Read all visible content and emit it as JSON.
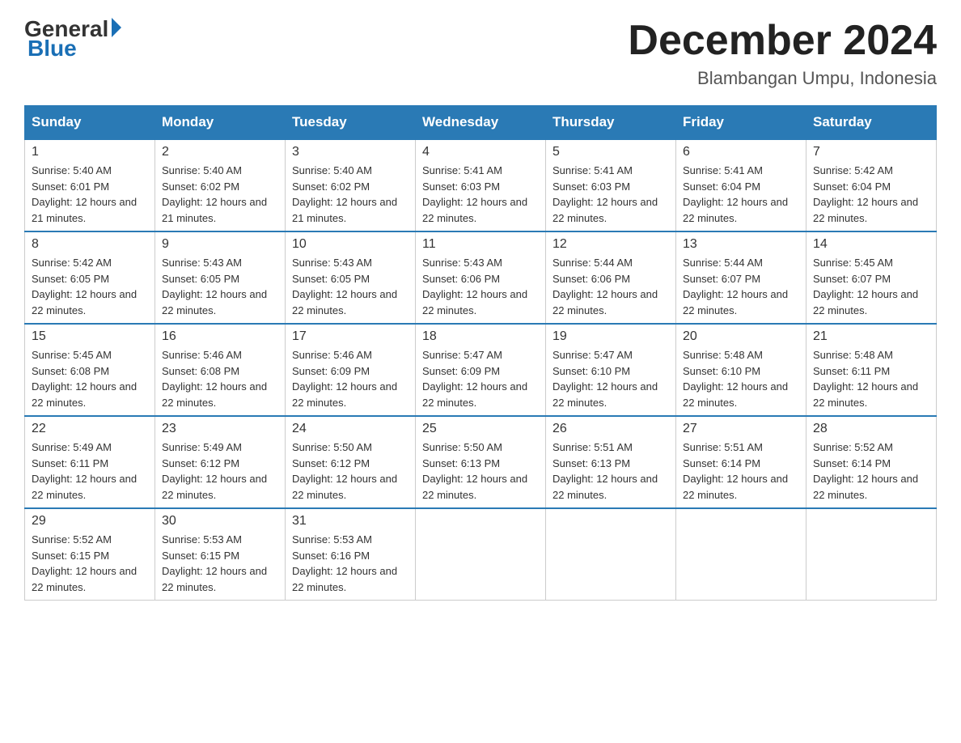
{
  "header": {
    "logo_general": "General",
    "logo_blue": "Blue",
    "month_title": "December 2024",
    "location": "Blambangan Umpu, Indonesia"
  },
  "days_of_week": [
    "Sunday",
    "Monday",
    "Tuesday",
    "Wednesday",
    "Thursday",
    "Friday",
    "Saturday"
  ],
  "weeks": [
    [
      {
        "day": "1",
        "sunrise": "5:40 AM",
        "sunset": "6:01 PM",
        "daylight": "12 hours and 21 minutes."
      },
      {
        "day": "2",
        "sunrise": "5:40 AM",
        "sunset": "6:02 PM",
        "daylight": "12 hours and 21 minutes."
      },
      {
        "day": "3",
        "sunrise": "5:40 AM",
        "sunset": "6:02 PM",
        "daylight": "12 hours and 21 minutes."
      },
      {
        "day": "4",
        "sunrise": "5:41 AM",
        "sunset": "6:03 PM",
        "daylight": "12 hours and 22 minutes."
      },
      {
        "day": "5",
        "sunrise": "5:41 AM",
        "sunset": "6:03 PM",
        "daylight": "12 hours and 22 minutes."
      },
      {
        "day": "6",
        "sunrise": "5:41 AM",
        "sunset": "6:04 PM",
        "daylight": "12 hours and 22 minutes."
      },
      {
        "day": "7",
        "sunrise": "5:42 AM",
        "sunset": "6:04 PM",
        "daylight": "12 hours and 22 minutes."
      }
    ],
    [
      {
        "day": "8",
        "sunrise": "5:42 AM",
        "sunset": "6:05 PM",
        "daylight": "12 hours and 22 minutes."
      },
      {
        "day": "9",
        "sunrise": "5:43 AM",
        "sunset": "6:05 PM",
        "daylight": "12 hours and 22 minutes."
      },
      {
        "day": "10",
        "sunrise": "5:43 AM",
        "sunset": "6:05 PM",
        "daylight": "12 hours and 22 minutes."
      },
      {
        "day": "11",
        "sunrise": "5:43 AM",
        "sunset": "6:06 PM",
        "daylight": "12 hours and 22 minutes."
      },
      {
        "day": "12",
        "sunrise": "5:44 AM",
        "sunset": "6:06 PM",
        "daylight": "12 hours and 22 minutes."
      },
      {
        "day": "13",
        "sunrise": "5:44 AM",
        "sunset": "6:07 PM",
        "daylight": "12 hours and 22 minutes."
      },
      {
        "day": "14",
        "sunrise": "5:45 AM",
        "sunset": "6:07 PM",
        "daylight": "12 hours and 22 minutes."
      }
    ],
    [
      {
        "day": "15",
        "sunrise": "5:45 AM",
        "sunset": "6:08 PM",
        "daylight": "12 hours and 22 minutes."
      },
      {
        "day": "16",
        "sunrise": "5:46 AM",
        "sunset": "6:08 PM",
        "daylight": "12 hours and 22 minutes."
      },
      {
        "day": "17",
        "sunrise": "5:46 AM",
        "sunset": "6:09 PM",
        "daylight": "12 hours and 22 minutes."
      },
      {
        "day": "18",
        "sunrise": "5:47 AM",
        "sunset": "6:09 PM",
        "daylight": "12 hours and 22 minutes."
      },
      {
        "day": "19",
        "sunrise": "5:47 AM",
        "sunset": "6:10 PM",
        "daylight": "12 hours and 22 minutes."
      },
      {
        "day": "20",
        "sunrise": "5:48 AM",
        "sunset": "6:10 PM",
        "daylight": "12 hours and 22 minutes."
      },
      {
        "day": "21",
        "sunrise": "5:48 AM",
        "sunset": "6:11 PM",
        "daylight": "12 hours and 22 minutes."
      }
    ],
    [
      {
        "day": "22",
        "sunrise": "5:49 AM",
        "sunset": "6:11 PM",
        "daylight": "12 hours and 22 minutes."
      },
      {
        "day": "23",
        "sunrise": "5:49 AM",
        "sunset": "6:12 PM",
        "daylight": "12 hours and 22 minutes."
      },
      {
        "day": "24",
        "sunrise": "5:50 AM",
        "sunset": "6:12 PM",
        "daylight": "12 hours and 22 minutes."
      },
      {
        "day": "25",
        "sunrise": "5:50 AM",
        "sunset": "6:13 PM",
        "daylight": "12 hours and 22 minutes."
      },
      {
        "day": "26",
        "sunrise": "5:51 AM",
        "sunset": "6:13 PM",
        "daylight": "12 hours and 22 minutes."
      },
      {
        "day": "27",
        "sunrise": "5:51 AM",
        "sunset": "6:14 PM",
        "daylight": "12 hours and 22 minutes."
      },
      {
        "day": "28",
        "sunrise": "5:52 AM",
        "sunset": "6:14 PM",
        "daylight": "12 hours and 22 minutes."
      }
    ],
    [
      {
        "day": "29",
        "sunrise": "5:52 AM",
        "sunset": "6:15 PM",
        "daylight": "12 hours and 22 minutes."
      },
      {
        "day": "30",
        "sunrise": "5:53 AM",
        "sunset": "6:15 PM",
        "daylight": "12 hours and 22 minutes."
      },
      {
        "day": "31",
        "sunrise": "5:53 AM",
        "sunset": "6:16 PM",
        "daylight": "12 hours and 22 minutes."
      },
      null,
      null,
      null,
      null
    ]
  ]
}
